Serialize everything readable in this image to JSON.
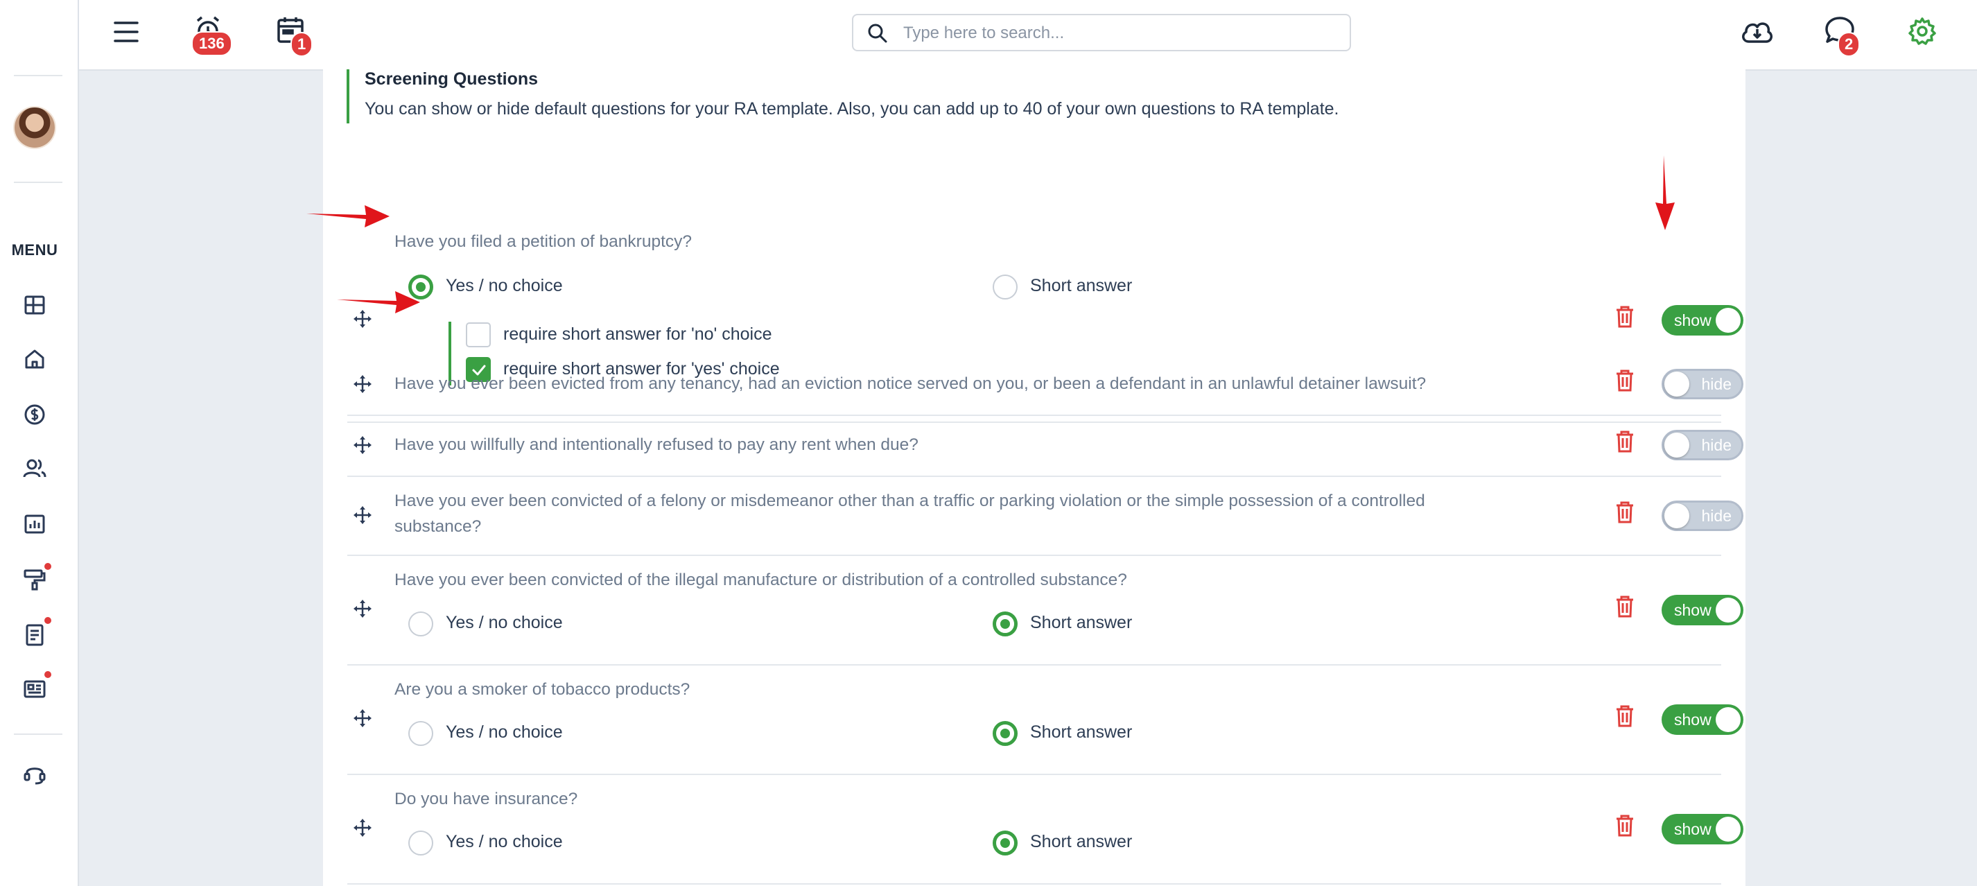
{
  "topbar": {
    "menu_icon": "hamburger-icon",
    "alarm_badge": "136",
    "calendar_badge": "1",
    "search_placeholder": "Type here to search...",
    "messages_badge": "2"
  },
  "sidebar": {
    "menu_label": "MENU",
    "items": [
      {
        "icon": "dashboard-icon"
      },
      {
        "icon": "home-icon"
      },
      {
        "icon": "dollar-icon"
      },
      {
        "icon": "users-icon"
      },
      {
        "icon": "chart-icon"
      },
      {
        "icon": "paint-roller-icon",
        "dot": true
      },
      {
        "icon": "document-icon",
        "dot": true
      },
      {
        "icon": "newspaper-icon",
        "dot": true
      },
      {
        "icon": "support-headset-icon"
      }
    ]
  },
  "section": {
    "title": "Screening Questions",
    "description": "You can show or hide default questions for your RA template. Also, you can add up to 40 of your own questions to RA template."
  },
  "options": {
    "yes_no": "Yes / no choice",
    "short_answer": "Short answer",
    "require_no": "require short answer for 'no' choice",
    "require_yes": "require short answer for 'yes' choice",
    "show": "show",
    "hide": "hide"
  },
  "questions": [
    {
      "text": "Have you filed a petition of bankruptcy?",
      "answer_type": "yes_no",
      "require_no": false,
      "require_yes": true,
      "visible": true
    },
    {
      "text": "Have you ever been evicted from any tenancy, had an eviction notice served on you, or been a defendant in an unlawful detainer lawsuit?",
      "visible": false
    },
    {
      "text": "Have you willfully and intentionally refused to pay any rent when due?",
      "visible": false
    },
    {
      "text": "Have you ever been convicted of a felony or misdemeanor other than a traffic or parking violation or the simple possession of a controlled substance?",
      "visible": false
    },
    {
      "text": "Have you ever been convicted of the illegal manufacture or distribution of a controlled substance?",
      "answer_type": "short",
      "visible": true
    },
    {
      "text": "Are you a smoker of tobacco products?",
      "answer_type": "short",
      "visible": true
    },
    {
      "text": "Do you have insurance?",
      "answer_type": "short",
      "visible": true
    }
  ],
  "colors": {
    "accent": "#3aa043",
    "badge": "#e03b3b",
    "annotation_arrow": "#e0151b",
    "background": "#e9edf2"
  }
}
